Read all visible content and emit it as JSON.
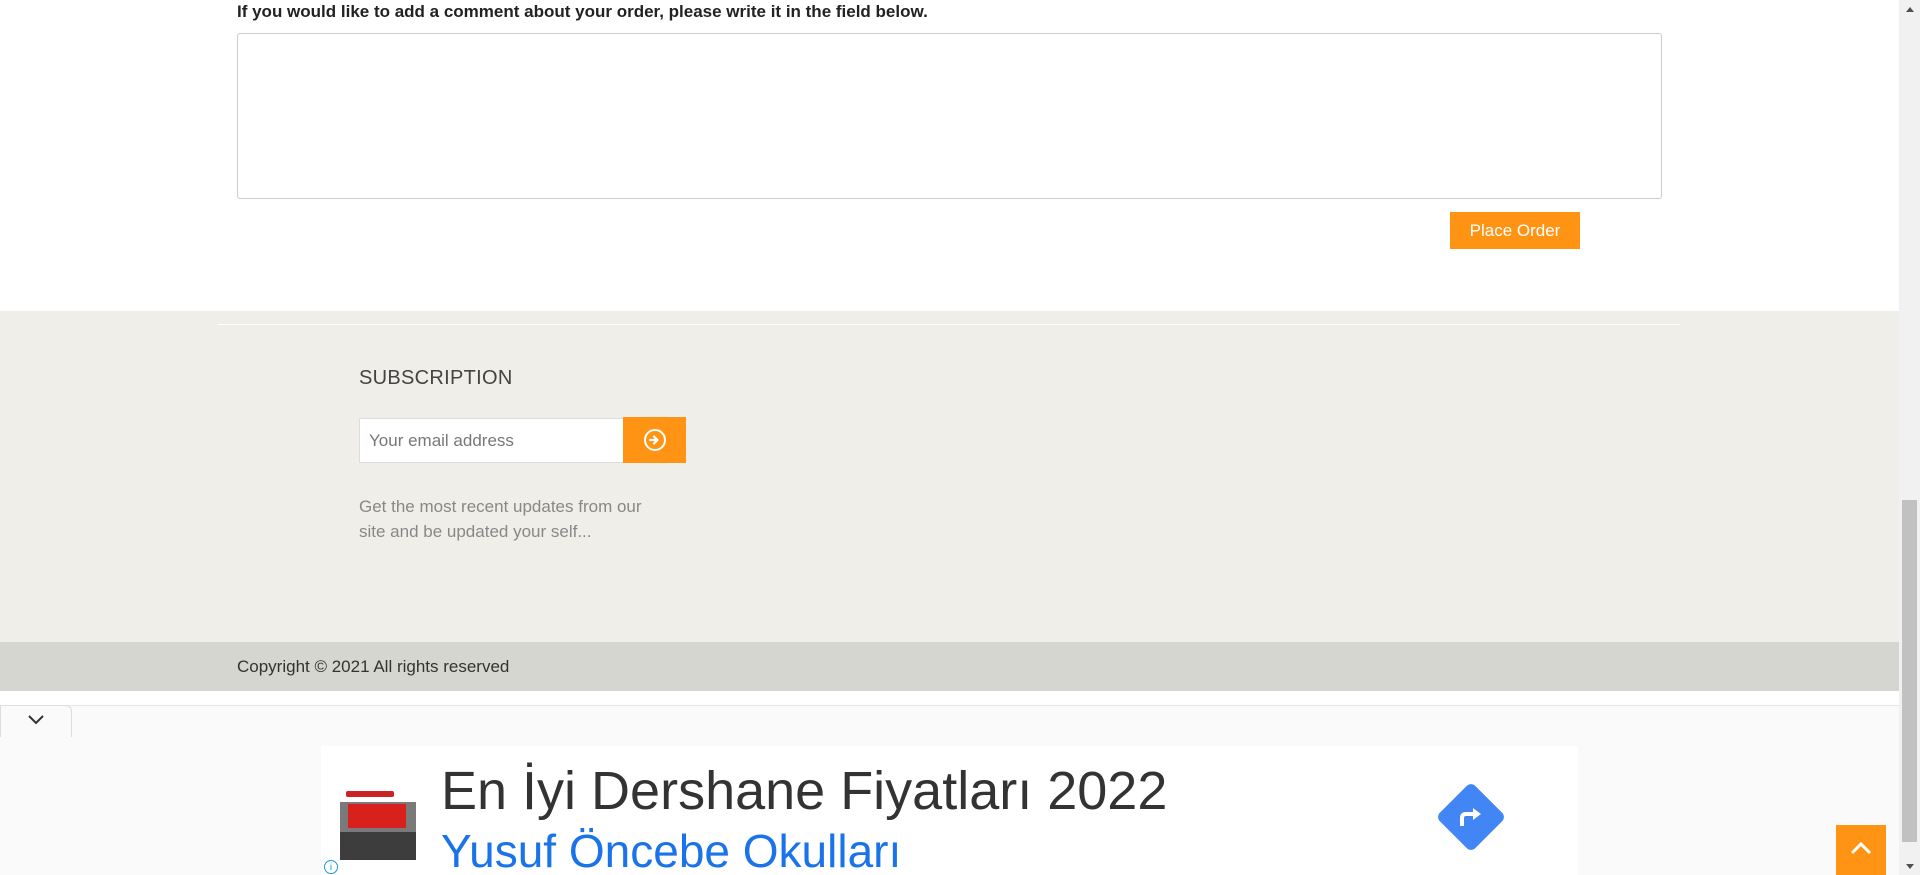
{
  "order": {
    "comment_label": "If you would like to add a comment about your order, please write it in the field below.",
    "comment_value": "",
    "place_order_label": "Place Order"
  },
  "footer": {
    "subscription_title": "SUBSCRIPTION",
    "email_placeholder": "Your email address",
    "subscribe_icon": "arrow-circle-right-icon",
    "description": "Get the most recent updates from our site and be updated your self...",
    "copyright": "Copyright © 2021 All rights reserved"
  },
  "ad": {
    "title": "En İyi Dershane Fiyatları 2022",
    "subtitle": "Yusuf Öncebe Okulları",
    "collapse_icon": "chevron-down-icon",
    "directions_icon": "directions-arrow-icon",
    "info_icon": "info-icon"
  },
  "colors": {
    "accent": "#ff9414",
    "footer_bg": "#efeee8",
    "copyright_bg": "#d6d6d0",
    "ad_link": "#1a73e8"
  }
}
